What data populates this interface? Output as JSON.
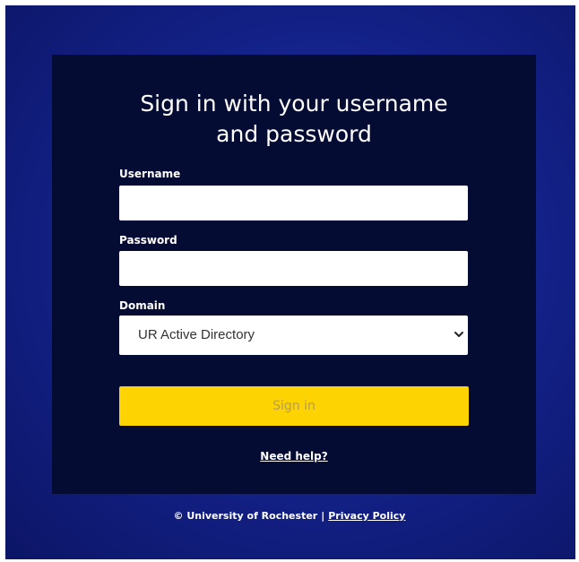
{
  "login": {
    "title_line1": "Sign in with your username",
    "title_line2": "and password",
    "username_label": "Username",
    "username_value": "",
    "password_label": "Password",
    "password_value": "",
    "domain_label": "Domain",
    "domain_selected": "UR Active Directory",
    "signin_label": "Sign in",
    "help_link": "Need help?"
  },
  "footer": {
    "copyright": "© University of Rochester",
    "separator": "|",
    "privacy_link": "Privacy Policy"
  },
  "colors": {
    "background": "#14238c",
    "card": "#050c34",
    "signin_button": "#fdd302",
    "signin_text": "#b59c5a"
  },
  "icons": {
    "domain_dropdown": "chevron-down-icon"
  }
}
